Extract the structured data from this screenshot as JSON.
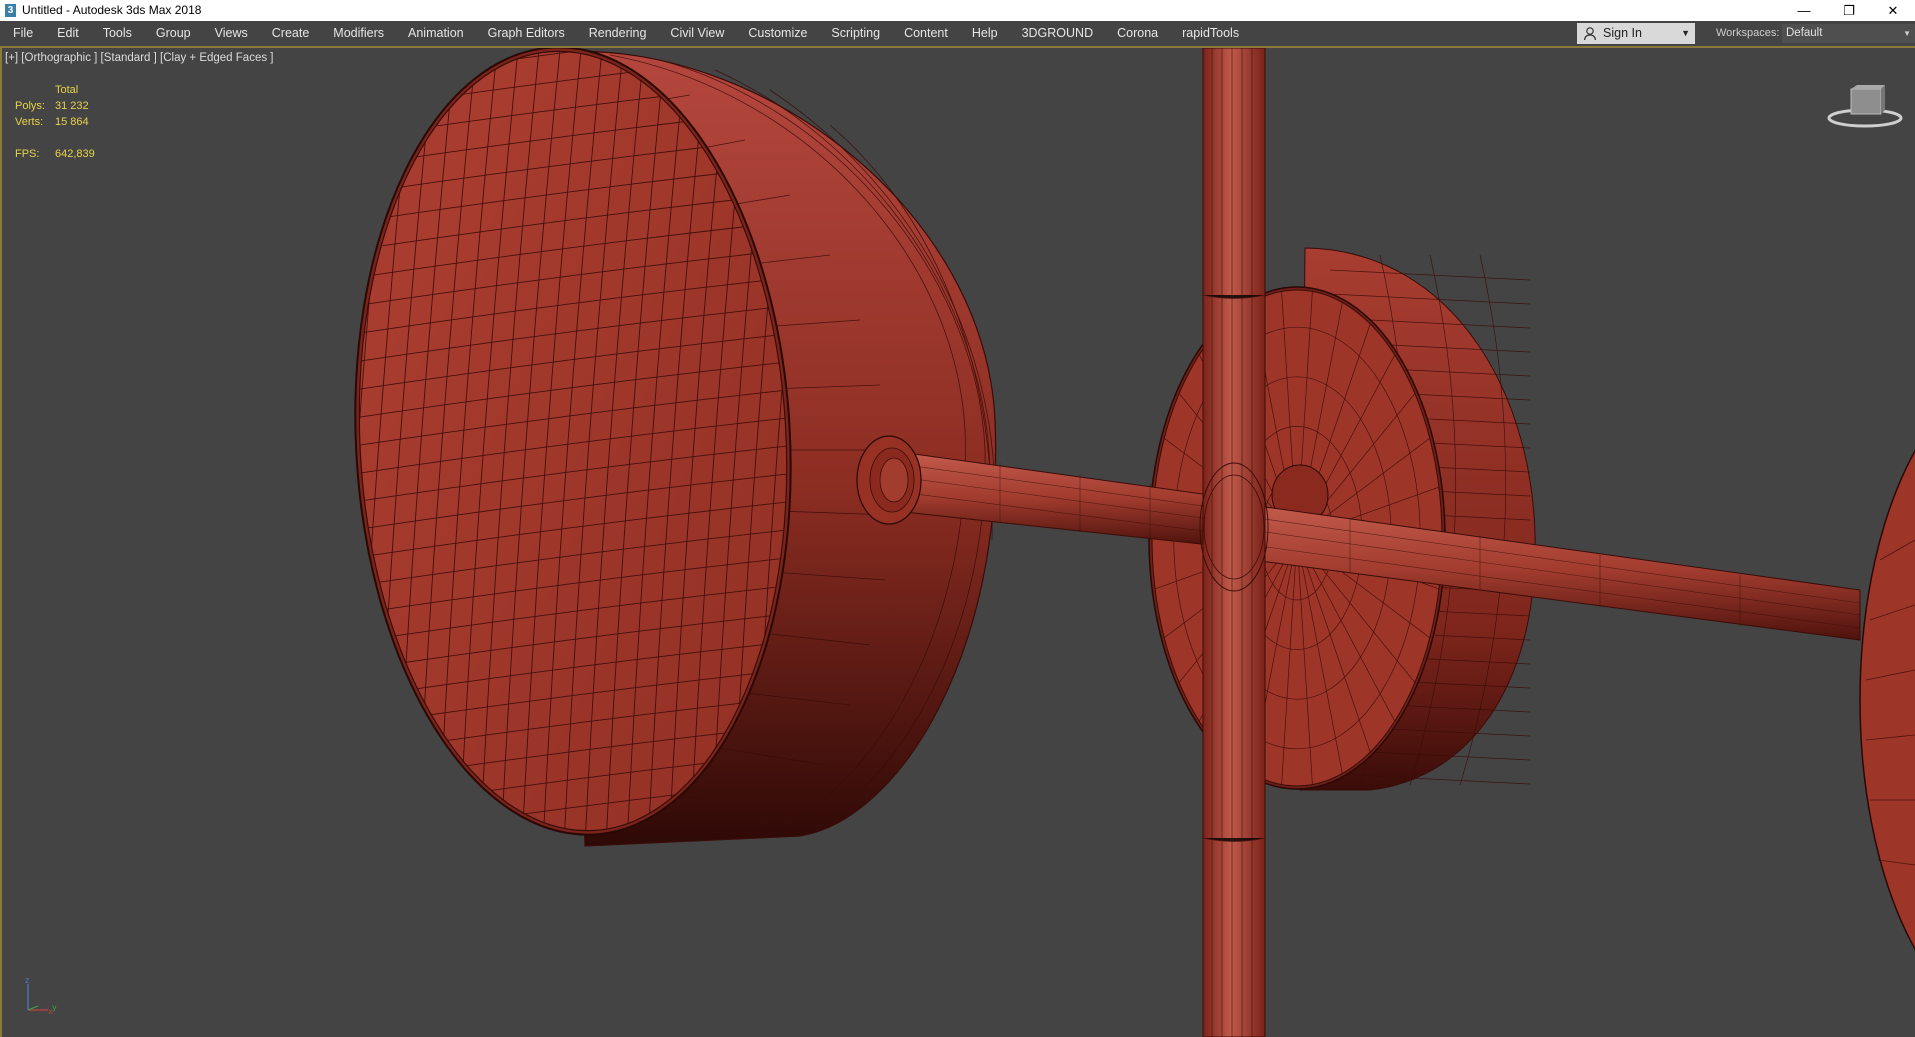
{
  "window": {
    "title": "Untitled - Autodesk 3ds Max 2018",
    "app_icon_glyph": "3",
    "controls": {
      "minimize": "—",
      "restore": "❐",
      "close": "✕"
    }
  },
  "menu": [
    "File",
    "Edit",
    "Tools",
    "Group",
    "Views",
    "Create",
    "Modifiers",
    "Animation",
    "Graph Editors",
    "Rendering",
    "Civil View",
    "Customize",
    "Scripting",
    "Content",
    "Help",
    "3DGROUND",
    "Corona",
    "rapidTools"
  ],
  "account": {
    "sign_in": "Sign In",
    "caret": "▼"
  },
  "workspaces": {
    "label": "Workspaces:",
    "value": "Default",
    "caret": "▼"
  },
  "viewport": {
    "label": "[+] [Orthographic ] [Standard ] [Clay + Edged Faces ]",
    "stats": {
      "header": "Total",
      "polys_label": "Polys:",
      "polys_value": "31 232",
      "verts_label": "Verts:",
      "verts_value": "15 864",
      "fps_label": "FPS:",
      "fps_value": "642,839"
    },
    "axis": {
      "z": "z",
      "x": "x",
      "y": "y"
    }
  },
  "colors": {
    "clay": "#b0473a",
    "clay_dark": "#6e2018",
    "wire": "#3a0c08",
    "viewport_bg": "#444444",
    "stats_text": "#e8d24a",
    "accent": "#8a7a3c"
  },
  "icons": {
    "user": "user-icon",
    "viewcube": "viewcube-icon",
    "axis": "axis-tripod-icon"
  }
}
